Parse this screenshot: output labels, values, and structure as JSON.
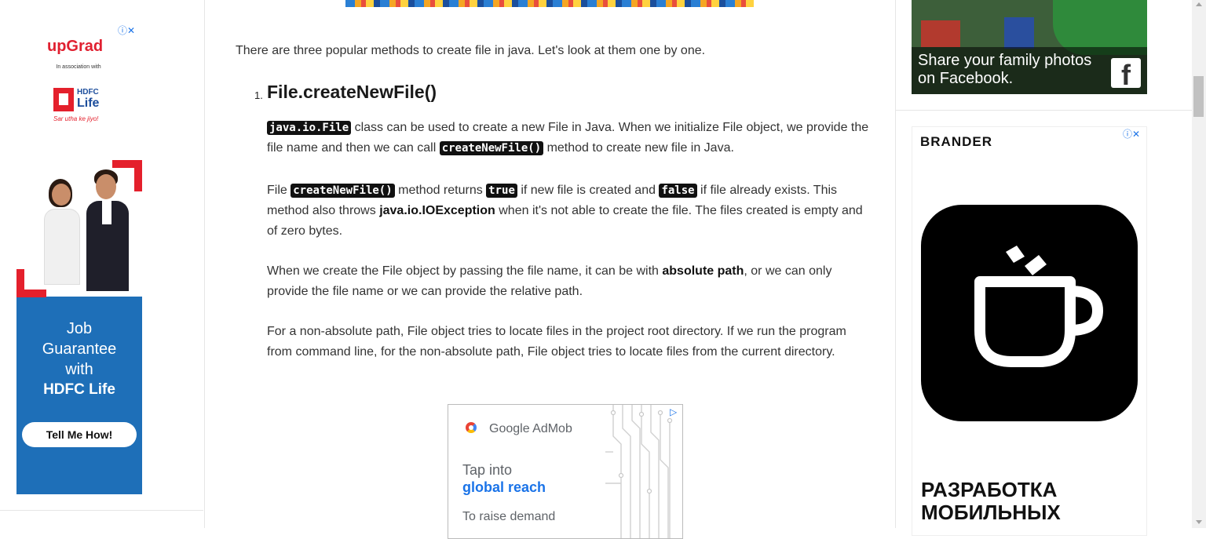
{
  "article": {
    "intro": "There are three popular methods to create file in java. Let's look at them one by one.",
    "heading_number": "1.",
    "heading": "File.createNewFile()",
    "p1": {
      "code1": "java.io.File",
      "t1": " class can be used to create a new File in Java. When we initialize File object, we provide the file name and then we can call ",
      "code2": "createNewFile()",
      "t2": " method to create new file in Java."
    },
    "p2": {
      "t0": "File ",
      "code1": "createNewFile()",
      "t1": " method returns ",
      "code2": "true",
      "t2": " if new file is created and ",
      "code3": "false",
      "t3": " if file already exists. This method also throws ",
      "bold": "java.io.IOException",
      "t4": " when it's not able to create the file. The files created is empty and of zero bytes."
    },
    "p3": {
      "t0": "When we create the File object by passing the file name, it can be with ",
      "bold": "absolute path",
      "t1": ", or we can only provide the file name or we can provide the relative path."
    },
    "p4": "For a non-absolute path, File object tries to locate files in the project root directory. If we run the program from command line, for the non-absolute path, File object tries to locate files from the current directory."
  },
  "ads": {
    "upgrad": {
      "logo": "upGrad",
      "assoc": "In association with",
      "hdfc_top": "HDFC",
      "hdfc_bottom": "Life",
      "tagline": "Sar utha ke jiyo!",
      "adchoice": "ⓘ✕"
    },
    "hdfc_banner": {
      "line1": "Job",
      "line2": "Guarantee",
      "line3": "with",
      "line4": "HDFC Life",
      "cta": "Tell Me How!"
    },
    "admob": {
      "brand": "Google AdMob",
      "line1": "Tap into",
      "line2": "global reach",
      "line3": "To raise demand",
      "adchoice": "▷"
    },
    "facebook": {
      "line1": "Share your family photos",
      "line2": "on Facebook.",
      "logo": "f"
    },
    "brander": {
      "name": "BRANDER",
      "adchoice": "ⓘ✕",
      "line1": "РАЗРАБОТКА",
      "line2": "МОБИЛЬНЫХ"
    }
  },
  "colors": {
    "code_bg": "#111111",
    "link_blue": "#1a73e8",
    "hdfc_red": "#e4202c",
    "hdfc_blue": "#1e6fb8"
  }
}
